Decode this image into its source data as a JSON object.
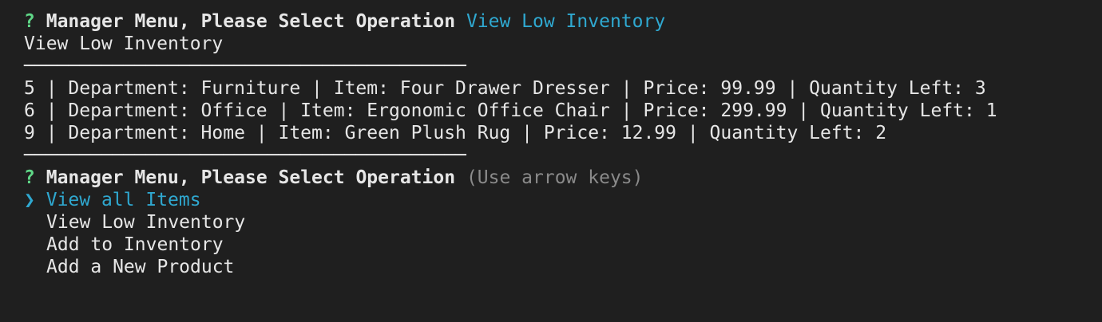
{
  "terminal": {
    "separator": "────────────────────────────────────────",
    "prompt1": {
      "qmark": "?",
      "question": "Manager Menu, Please Select Operation",
      "answer": "View Low Inventory"
    },
    "echo": "View Low Inventory",
    "rows": [
      "5 | Department: Furniture | Item: Four Drawer Dresser | Price: 99.99 | Quantity Left: 3",
      "6 | Department: Office | Item: Ergonomic Office Chair | Price: 299.99 | Quantity Left: 1",
      "9 | Department: Home | Item: Green Plush Rug | Price: 12.99 | Quantity Left: 2"
    ],
    "prompt2": {
      "qmark": "?",
      "question": "Manager Menu, Please Select Operation",
      "hint": "(Use arrow keys)"
    },
    "menu": {
      "pointer": "❯",
      "options": [
        "View all Items",
        "View Low Inventory",
        "Add to Inventory",
        "Add a New Product"
      ],
      "selected_index": 0
    }
  }
}
